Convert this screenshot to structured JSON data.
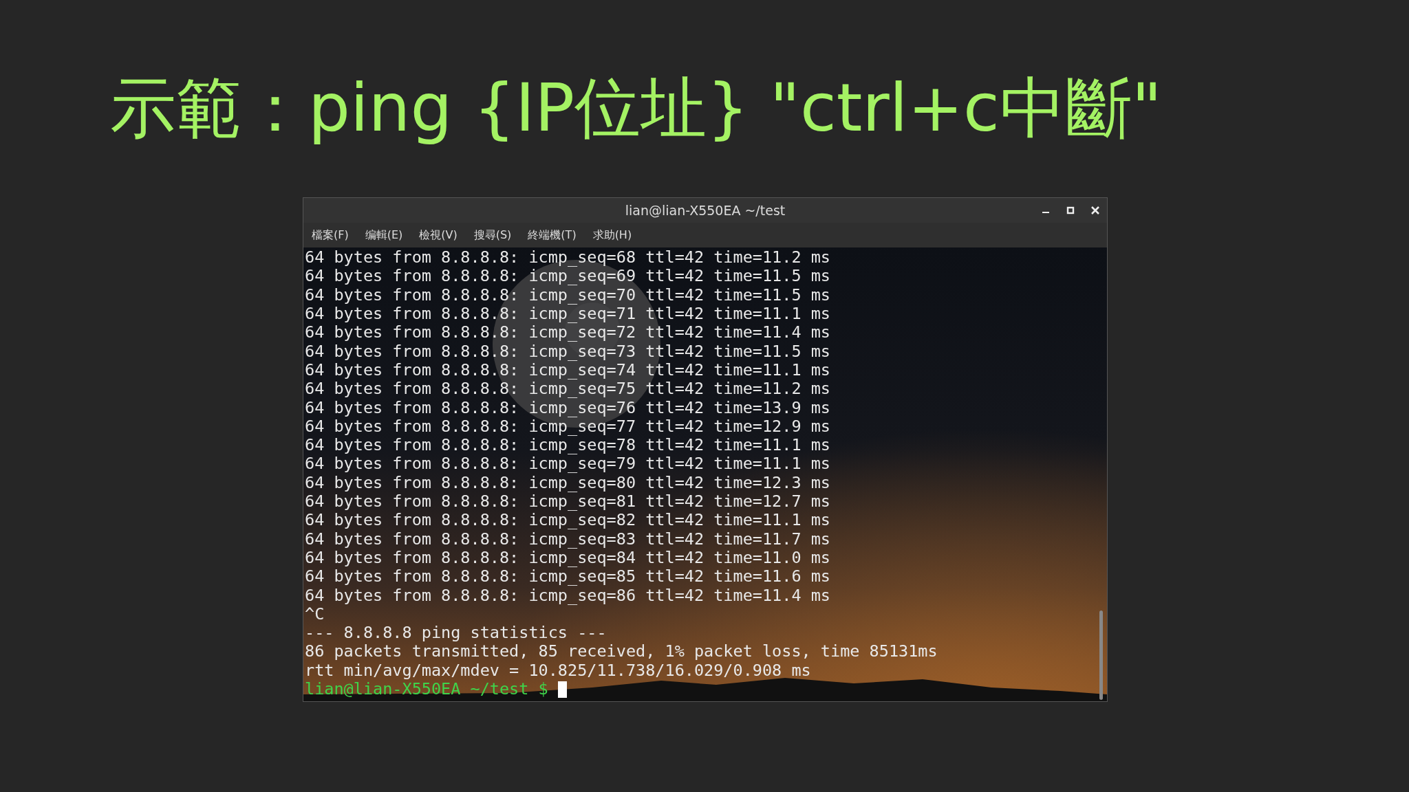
{
  "slide_title": "示範：ping {IP位址} \"ctrl+c中斷\"",
  "window": {
    "title": "lian@lian-X550EA ~/test"
  },
  "menu": [
    {
      "label": "檔案(F)"
    },
    {
      "label": "编輯(E)"
    },
    {
      "label": "檢視(V)"
    },
    {
      "label": "搜尋(S)"
    },
    {
      "label": "終端機(T)"
    },
    {
      "label": "求助(H)"
    }
  ],
  "terminal": {
    "lines": [
      "64 bytes from 8.8.8.8: icmp_seq=68 ttl=42 time=11.2 ms",
      "64 bytes from 8.8.8.8: icmp_seq=69 ttl=42 time=11.5 ms",
      "64 bytes from 8.8.8.8: icmp_seq=70 ttl=42 time=11.5 ms",
      "64 bytes from 8.8.8.8: icmp_seq=71 ttl=42 time=11.1 ms",
      "64 bytes from 8.8.8.8: icmp_seq=72 ttl=42 time=11.4 ms",
      "64 bytes from 8.8.8.8: icmp_seq=73 ttl=42 time=11.5 ms",
      "64 bytes from 8.8.8.8: icmp_seq=74 ttl=42 time=11.1 ms",
      "64 bytes from 8.8.8.8: icmp_seq=75 ttl=42 time=11.2 ms",
      "64 bytes from 8.8.8.8: icmp_seq=76 ttl=42 time=13.9 ms",
      "64 bytes from 8.8.8.8: icmp_seq=77 ttl=42 time=12.9 ms",
      "64 bytes from 8.8.8.8: icmp_seq=78 ttl=42 time=11.1 ms",
      "64 bytes from 8.8.8.8: icmp_seq=79 ttl=42 time=11.1 ms",
      "64 bytes from 8.8.8.8: icmp_seq=80 ttl=42 time=12.3 ms",
      "64 bytes from 8.8.8.8: icmp_seq=81 ttl=42 time=12.7 ms",
      "64 bytes from 8.8.8.8: icmp_seq=82 ttl=42 time=11.1 ms",
      "64 bytes from 8.8.8.8: icmp_seq=83 ttl=42 time=11.7 ms",
      "64 bytes from 8.8.8.8: icmp_seq=84 ttl=42 time=11.0 ms",
      "64 bytes from 8.8.8.8: icmp_seq=85 ttl=42 time=11.6 ms",
      "64 bytes from 8.8.8.8: icmp_seq=86 ttl=42 time=11.4 ms",
      "^C",
      "--- 8.8.8.8 ping statistics ---",
      "86 packets transmitted, 85 received, 1% packet loss, time 85131ms",
      "rtt min/avg/max/mdev = 10.825/11.738/16.029/0.908 ms"
    ],
    "prompt": "lian@lian-X550EA ~/test $"
  }
}
